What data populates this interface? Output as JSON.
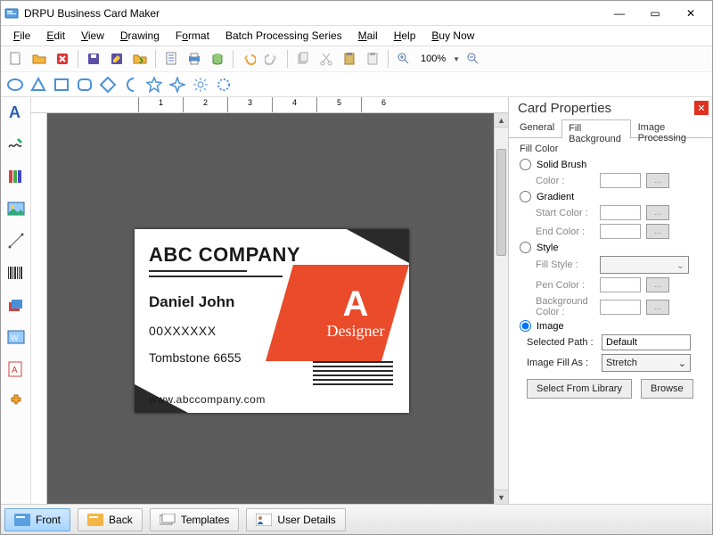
{
  "window": {
    "title": "DRPU Business Card Maker"
  },
  "menu": {
    "file": "File",
    "edit": "Edit",
    "view": "View",
    "drawing": "Drawing",
    "format": "Format",
    "batch": "Batch Processing Series",
    "mail": "Mail",
    "help": "Help",
    "buy": "Buy Now"
  },
  "toolbar": {
    "zoom": "100%"
  },
  "card": {
    "company": "ABC COMPANY",
    "name": "Daniel John",
    "number": "00XXXXXX",
    "city_zip": "Tombstone 6655",
    "website": "www.abccompany.com",
    "designer": "Designer",
    "logo_letter": "A"
  },
  "props": {
    "title": "Card Properties",
    "tabs": {
      "general": "General",
      "fill_bg": "Fill Background",
      "img_proc": "Image Processing"
    },
    "fill_color_title": "Fill Color",
    "solid_brush": "Solid Brush",
    "color_label": "Color :",
    "gradient": "Gradient",
    "start_color": "Start Color :",
    "end_color": "End Color :",
    "style": "Style",
    "fill_style": "Fill Style :",
    "pen_color": "Pen Color :",
    "bg_color": "Background Color :",
    "image": "Image",
    "selected_path_label": "Selected Path :",
    "selected_path_value": "Default",
    "image_fill_as_label": "Image Fill As :",
    "image_fill_as_value": "Stretch",
    "select_from_library": "Select From Library",
    "browse": "Browse",
    "dots": "..."
  },
  "bottom_tabs": {
    "front": "Front",
    "back": "Back",
    "templates": "Templates",
    "user_details": "User Details"
  },
  "ruler": [
    "1",
    "2",
    "3",
    "4",
    "5",
    "6"
  ]
}
